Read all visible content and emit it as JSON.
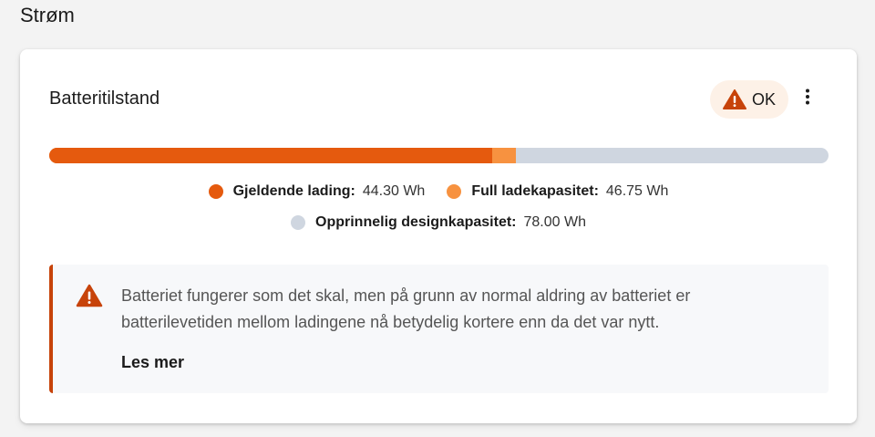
{
  "section": {
    "title": "Strøm"
  },
  "card": {
    "title": "Batteritilstand",
    "status": {
      "label": "OK",
      "icon": "warning-icon",
      "color": "#c7430a"
    },
    "menu_icon": "more-vertical-icon"
  },
  "battery": {
    "design_capacity_wh": 78.0,
    "full_capacity_wh": 46.75,
    "current_charge_wh": 44.3,
    "colors": {
      "current": "#e55a0e",
      "full": "#f79240",
      "design": "#cfd6e0"
    }
  },
  "legend": [
    {
      "label": "Gjeldende lading:",
      "value": "44.30 Wh",
      "color": "#e55a0e"
    },
    {
      "label": "Full ladekapasitet:",
      "value": "46.75 Wh",
      "color": "#f79240"
    },
    {
      "label": "Opprinnelig designkapasitet:",
      "value": "78.00 Wh",
      "color": "#cfd6e0"
    }
  ],
  "notice": {
    "icon": "warning-icon",
    "text": "Batteriet fungerer som det skal, men på grunn av normal aldring av batteriet er batterilevetiden mellom ladingene nå betydelig kortere enn da det var nytt.",
    "link": "Les mer"
  }
}
